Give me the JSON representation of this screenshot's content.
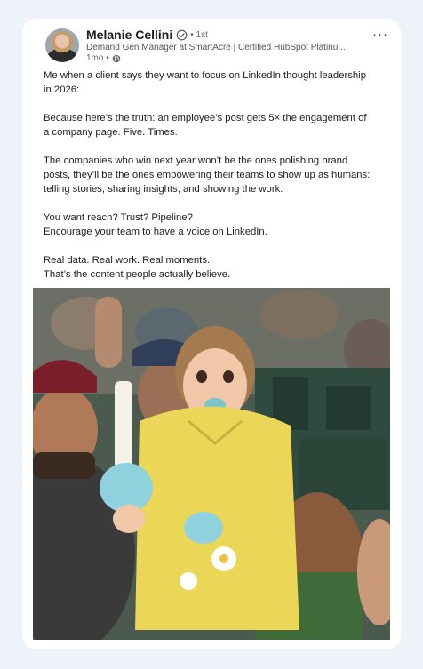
{
  "post": {
    "author_name": "Melanie Cellini",
    "degree": "• 1st",
    "headline": "Demand Gen Manager at SmartAcre | Certified HubSpot Platinu...",
    "time": "1mo •",
    "more_label": "···",
    "body_paragraphs": [
      [
        "Me when a client says they want to focus on LinkedIn thought leadership",
        "in 2026:"
      ],
      [
        "Because here’s the truth: an employee’s post gets 5× the engagement of",
        "a company page. Five. Times."
      ],
      [
        "The companies who win next year won’t be the ones polishing brand",
        "posts, they’ll be the ones empowering their teams to show up as humans:",
        "telling stories, sharing insights, and showing the work."
      ],
      [
        "You want reach? Trust? Pipeline?",
        "Encourage your team to have a voice on LinkedIn."
      ],
      [
        "Real data. Real work. Real moments.",
        "That’s the content people actually believe."
      ]
    ]
  },
  "icons": {
    "verified": "verified-badge-icon",
    "visibility": "globe-icon",
    "more": "more-options-icon"
  },
  "colors": {
    "page_background": "#eef3f9",
    "card_background": "#ffffff",
    "text_primary": "#1d1d1d",
    "text_secondary": "#666666"
  }
}
